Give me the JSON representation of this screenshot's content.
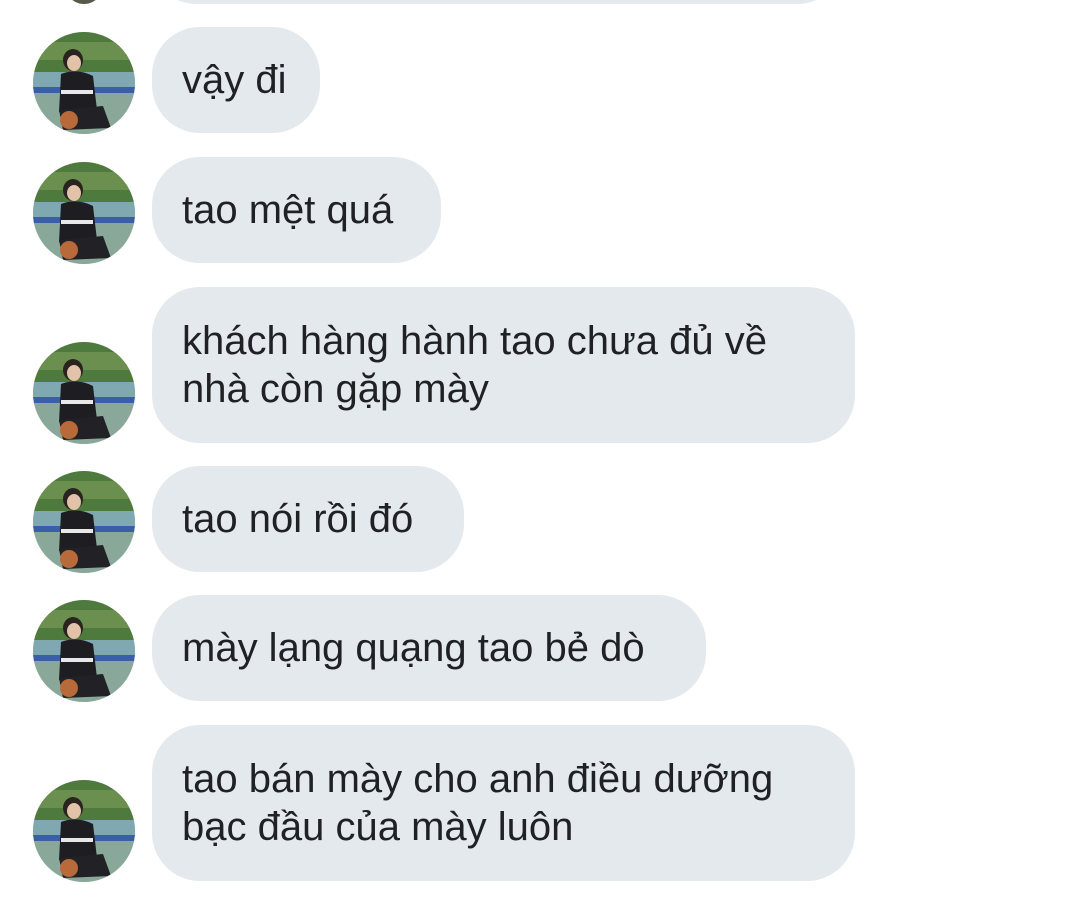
{
  "conversation": {
    "messages": [
      {
        "text": "vậy đi"
      },
      {
        "text": "tao mệt quá"
      },
      {
        "text": "khách hàng hành tao chưa đủ về\nnhà còn gặp mày"
      },
      {
        "text": "tao nói rồi đó"
      },
      {
        "text": "mày lạng quạng tao bẻ dò"
      },
      {
        "text": "tao bán mày cho anh điều dưỡng\nbạc đầu của mày luôn"
      }
    ]
  },
  "colors": {
    "bubble_bg": "#e4e9ee",
    "text": "#1f2124",
    "background": "#ffffff"
  }
}
